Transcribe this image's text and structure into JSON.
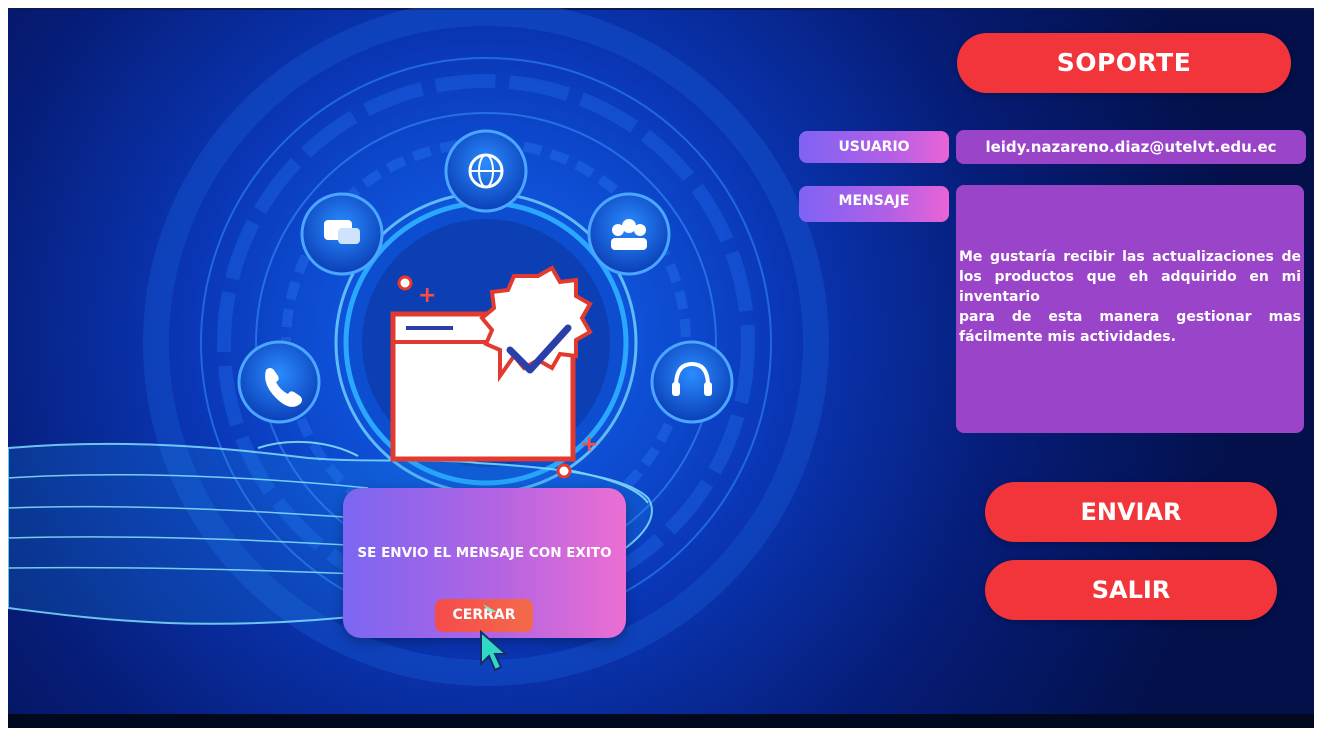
{
  "header": {
    "title": "SOPORTE"
  },
  "form": {
    "usuario_label": "USUARIO",
    "usuario_value": "leidy.nazareno.diaz@utelvt.edu.ec",
    "mensaje_label": "MENSAJE",
    "mensaje_value": "Me gustaría recibir las actualizaciones de los productos que eh adquirido en mi inventario\npara de esta manera gestionar mas fácilmente mis actividades."
  },
  "actions": {
    "enviar_label": "ENVIAR",
    "salir_label": "SALIR"
  },
  "dialog": {
    "message": "SE ENVIO EL MENSAJE CON EXITO",
    "close_label": "CERRAR"
  },
  "icons": [
    "chat-icon",
    "globe-icon",
    "group-icon",
    "phone-icon",
    "headset-icon",
    "checkmark-badge-icon",
    "browser-window-icon",
    "cursor-icon"
  ],
  "colors": {
    "accent_red": "#f2343b",
    "field_purple": "#9a44c9",
    "label_gradient_start": "#7f63f4",
    "label_gradient_end": "#ea64d5",
    "background_blue": "#0a36b5"
  }
}
